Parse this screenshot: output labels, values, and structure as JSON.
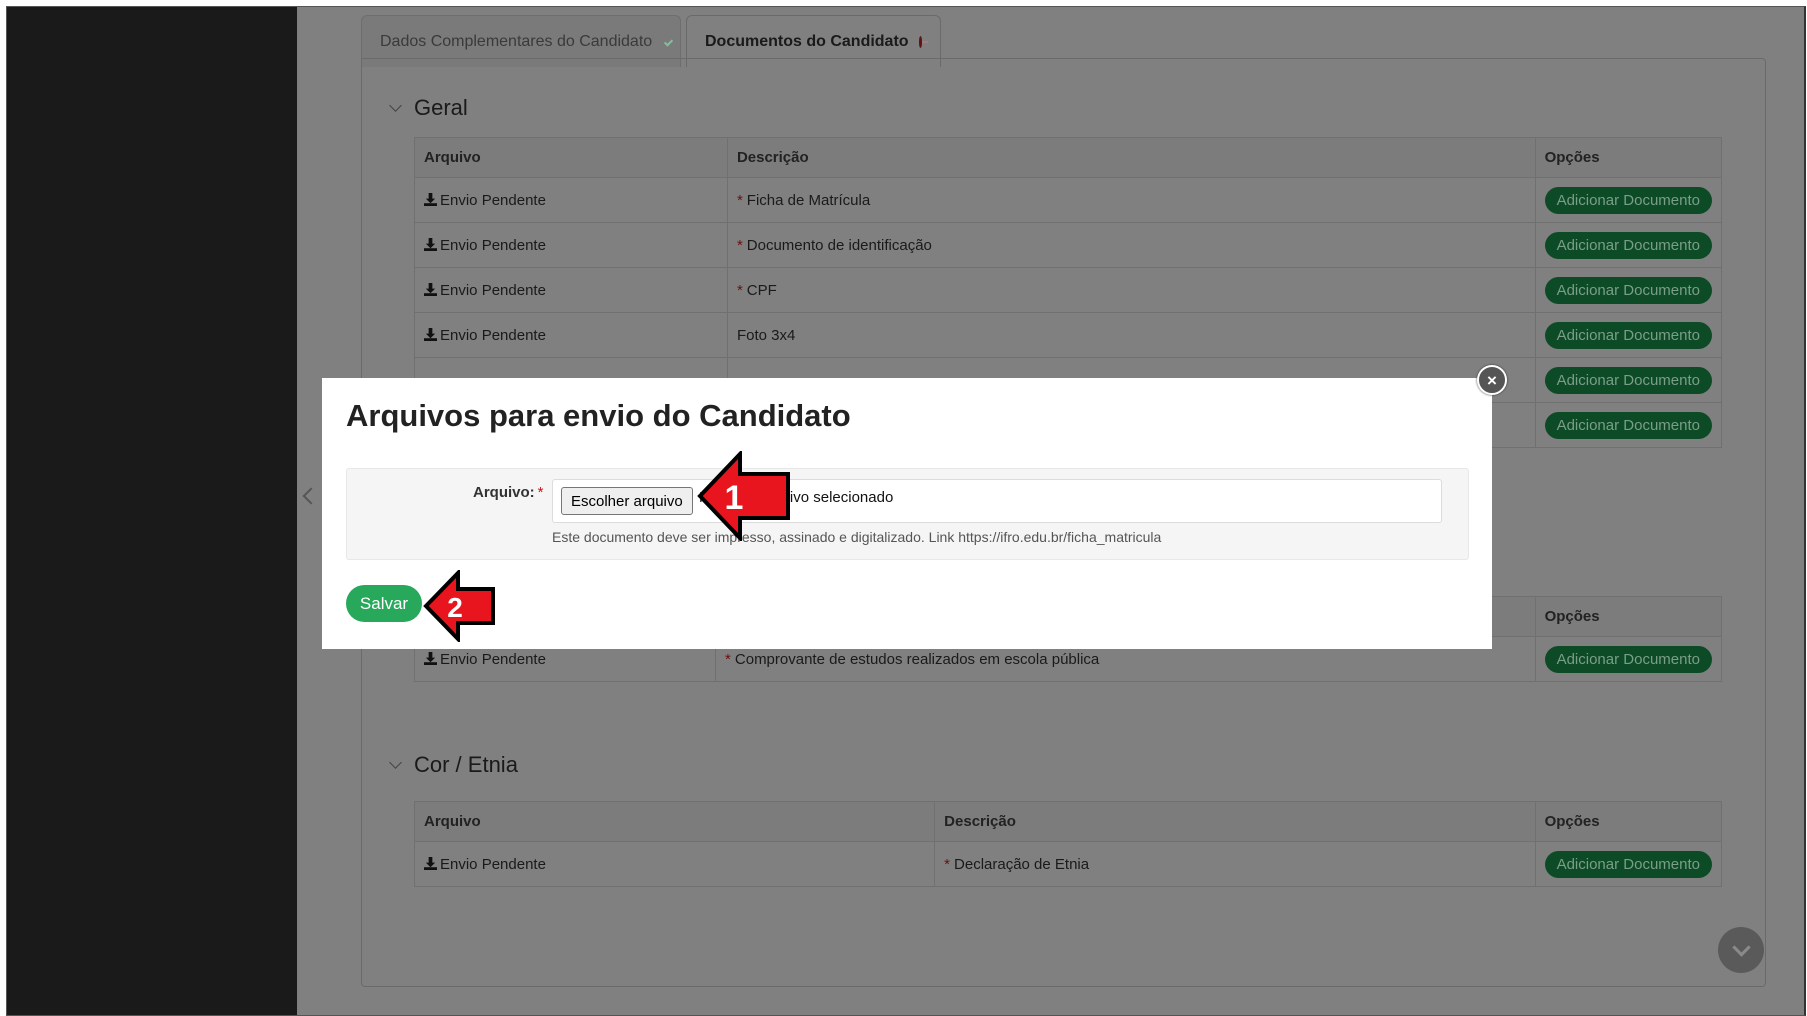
{
  "tabs": [
    {
      "label": "Dados Complementares do Candidato",
      "status": "complete"
    },
    {
      "label": "Documentos do Candidato",
      "status": "pending"
    }
  ],
  "sections": {
    "geral": {
      "title": "Geral",
      "headers": [
        "Arquivo",
        "Descrição",
        "Opções"
      ],
      "rows": [
        {
          "arquivo": "Envio Pendente",
          "required": "*",
          "descricao": "Ficha de Matrícula",
          "action": "Adicionar Documento"
        },
        {
          "arquivo": "Envio Pendente",
          "required": "*",
          "descricao": "Documento de identificação",
          "action": "Adicionar Documento"
        },
        {
          "arquivo": "Envio Pendente",
          "required": "*",
          "descricao": "CPF",
          "action": "Adicionar Documento"
        },
        {
          "arquivo": "Envio Pendente",
          "required": "",
          "descricao": "Foto 3x4",
          "action": "Adicionar Documento"
        }
      ],
      "extra_actions": [
        "Adicionar Documento",
        "Adicionar Documento"
      ]
    },
    "escola": {
      "headers": [
        "Opções"
      ],
      "rows": [
        {
          "arquivo": "Envio Pendente",
          "required": "*",
          "descricao": "Comprovante de estudos realizados em escola pública",
          "action": "Adicionar Documento"
        }
      ]
    },
    "etnia": {
      "title": "Cor / Etnia",
      "headers": [
        "Arquivo",
        "Descrição",
        "Opções"
      ],
      "rows": [
        {
          "arquivo": "Envio Pendente",
          "required": "*",
          "descricao": "Declaração de Etnia",
          "action": "Adicionar Documento"
        }
      ]
    }
  },
  "modal": {
    "title": "Arquivos para envio do Candidato",
    "close_glyph": "×",
    "field_label": "Arquivo:",
    "required_mark": "*",
    "choose_button": "Escolher arquivo",
    "file_status": "Nenhum arquivo selecionado",
    "help_text": "Este documento deve ser impresso, assinado e digitalizado. Link https://ifro.edu.br/ficha_matricula",
    "save_button": "Salvar"
  },
  "annotations": {
    "arrow_1": "1",
    "arrow_2": "2",
    "color": "#e8141e"
  },
  "colors": {
    "overlay": "#808080",
    "sidebar": "#1a1a1a",
    "save": "#27a85a",
    "add_button_dimmed": "#0d4a26"
  }
}
